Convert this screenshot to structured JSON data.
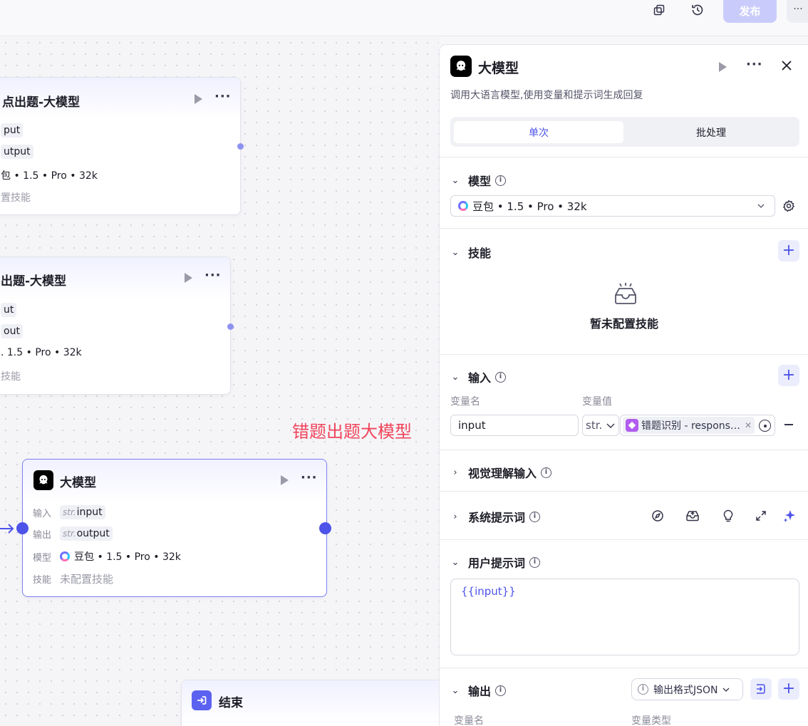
{
  "topbar": {
    "publish_label": "发布"
  },
  "canvas": {
    "nodes": [
      {
        "title": "点出题-大模型",
        "input_tag": "put",
        "output_tag": "utput",
        "model": "包 • 1.5 • Pro • 32k",
        "skill": "置技能"
      },
      {
        "title": "出题-大模型",
        "input_tag": "ut",
        "output_tag": "out",
        "model": ". 1.5 • Pro • 32k",
        "skill": "技能"
      }
    ],
    "annotation": "错题出题大模型",
    "selected_node": {
      "title": "大模型",
      "input_label": "输入",
      "input_type": "str.",
      "input_value": "input",
      "output_label": "输出",
      "output_type": "str.",
      "output_value": "output",
      "model_label": "模型",
      "model_value": "豆包 • 1.5 • Pro • 32k",
      "skill_label": "技能",
      "skill_value": "未配置技能"
    },
    "end_node": {
      "title": "结束"
    }
  },
  "panel": {
    "title": "大模型",
    "description": "调用大语言模型,使用变量和提示词生成回复",
    "tabs": [
      {
        "label": "单次",
        "active": true
      },
      {
        "label": "批处理",
        "active": false
      }
    ],
    "model_section": {
      "title": "模型",
      "selected": "豆包 • 1.5 • Pro • 32k"
    },
    "skill_section": {
      "title": "技能",
      "empty_text": "暂未配置技能"
    },
    "input_section": {
      "title": "输入",
      "col_name": "变量名",
      "col_value": "变量值",
      "var_name": "input",
      "var_type": "str.",
      "ref_value": "错题识别 - respons…"
    },
    "visual_section": {
      "title": "视觉理解输入"
    },
    "system_prompt_section": {
      "title": "系统提示词"
    },
    "user_prompt_section": {
      "title": "用户提示词",
      "content": "{{input}}"
    },
    "output_section": {
      "title": "输出",
      "format_label": "输出格式JSON",
      "col_name": "变量名",
      "col_type": "变量类型"
    }
  },
  "colors": {
    "accent": "#4d53e8",
    "annotation": "#f0445a",
    "publish_disabled": "#c9ccfb"
  }
}
